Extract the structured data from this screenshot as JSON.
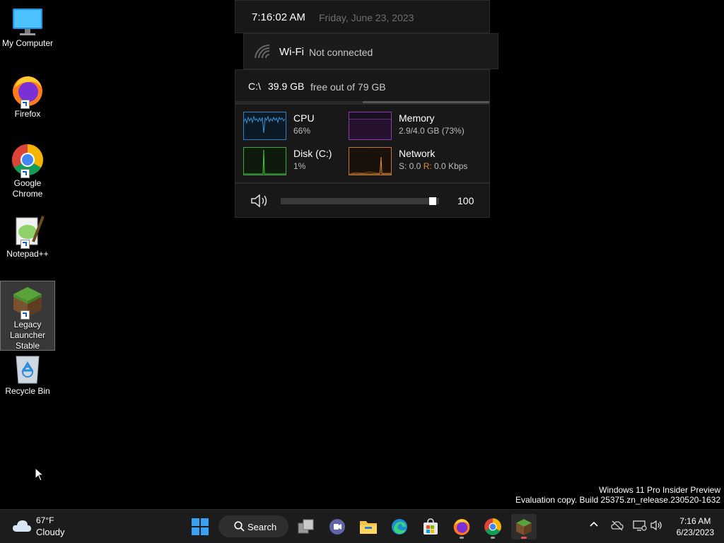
{
  "desktop": {
    "icons": [
      {
        "label": "My Computer"
      },
      {
        "label": "Firefox"
      },
      {
        "label": "Google Chrome"
      },
      {
        "label": "Notepad++"
      },
      {
        "label": "Legacy Launcher Stable"
      },
      {
        "label": "Recycle Bin"
      }
    ]
  },
  "widget": {
    "time": "7:16:02 AM",
    "date": "Friday, June 23, 2023",
    "wifi": {
      "name": "Wi-Fi",
      "status": "Not connected"
    },
    "drive": {
      "letter": "C:\\",
      "free": "39.9 GB",
      "of_text": "free out of 79 GB",
      "used_fraction": 0.5
    },
    "perf": {
      "cpu": {
        "name": "CPU",
        "value": "66%",
        "color": "#2f7fc1"
      },
      "memory": {
        "name": "Memory",
        "value": "2.9/4.0 GB (73%)",
        "color": "#8c3bb3"
      },
      "disk": {
        "name": "Disk (C:)",
        "value": "1%",
        "color": "#3fa83a"
      },
      "network": {
        "name": "Network",
        "value_s": "S: 0.0",
        "value_r_label": "R:",
        "value_r": "0.0 Kbps",
        "color": "#c8742a"
      }
    },
    "volume": {
      "level": 100,
      "label": "100"
    }
  },
  "watermark": {
    "line1": "Windows 11 Pro Insider Preview",
    "line2": "Evaluation copy. Build 25375.zn_release.230520-1632"
  },
  "taskbar": {
    "weather": {
      "temp": "67°F",
      "condition": "Cloudy"
    },
    "search_label": "Search",
    "clock_time": "7:16 AM",
    "clock_date": "6/23/2023"
  },
  "colors": {
    "accent": "#0078d4",
    "taskbar_bg": "#1c1c1c",
    "panel_bg": "#181818"
  }
}
